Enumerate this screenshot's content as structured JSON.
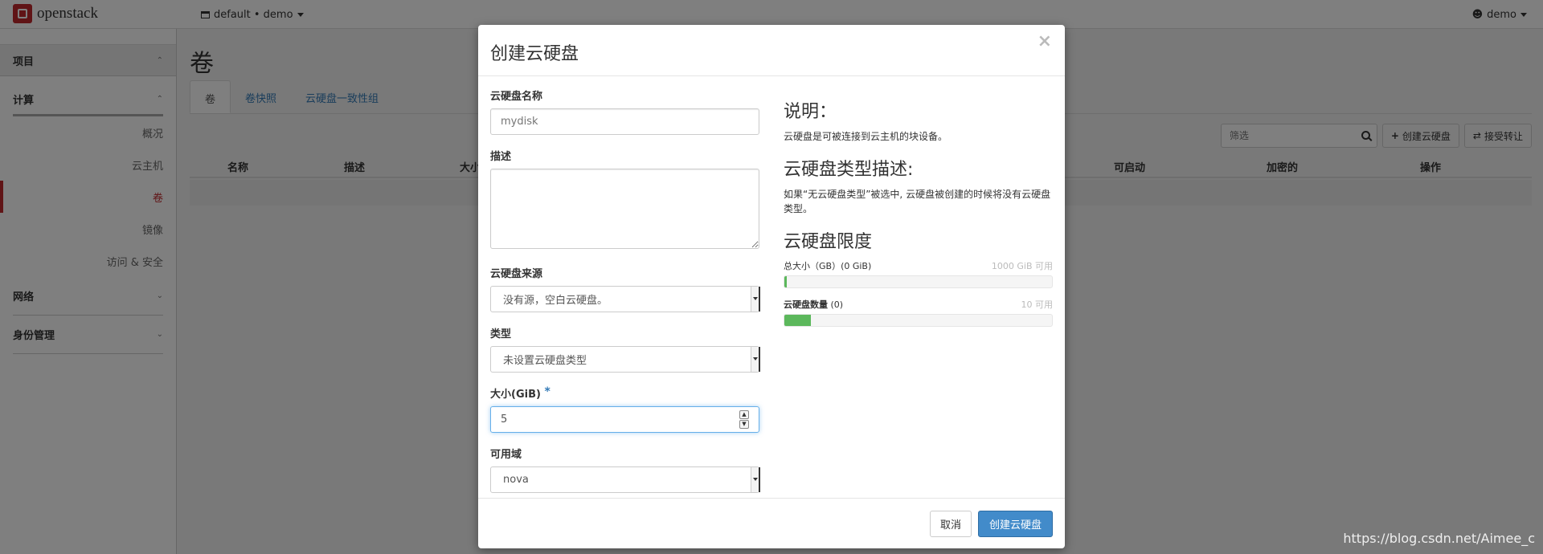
{
  "navbar": {
    "brand": "openstack",
    "project": "default • demo",
    "user": "demo"
  },
  "sidebar": {
    "groups": [
      {
        "label": "项目"
      },
      {
        "label": "计算"
      },
      {
        "label": "网络"
      },
      {
        "label": "身份管理"
      }
    ],
    "compute_items": [
      {
        "label": "概况"
      },
      {
        "label": "云主机"
      },
      {
        "label": "卷"
      },
      {
        "label": "镜像"
      },
      {
        "label": "访问 & 安全"
      }
    ]
  },
  "main": {
    "title": "卷",
    "tabs": [
      {
        "label": "卷"
      },
      {
        "label": "卷快照"
      },
      {
        "label": "云硬盘一致性组"
      }
    ],
    "filter_placeholder": "筛选",
    "create_button": "创建云硬盘",
    "accept_transfer_button": "接受转让",
    "columns": [
      "名称",
      "描述",
      "大小",
      "可启动",
      "加密的",
      "操作"
    ]
  },
  "modal": {
    "title": "创建云硬盘",
    "close": "×",
    "fields": {
      "name_label": "云硬盘名称",
      "name_placeholder": "mydisk",
      "desc_label": "描述",
      "source_label": "云硬盘来源",
      "source_value": "没有源，空白云硬盘。",
      "type_label": "类型",
      "type_value": "未设置云硬盘类型",
      "size_label": "大小(GiB)",
      "size_required": "*",
      "size_value": "5",
      "az_label": "可用域",
      "az_value": "nova"
    },
    "info": {
      "desc_heading": "说明：",
      "desc_text": "云硬盘是可被连接到云主机的块设备。",
      "type_heading": "云硬盘类型描述:",
      "type_text": "如果“无云硬盘类型”被选中, 云硬盘被创建的时候将没有云硬盘类型。",
      "limits_heading": "云硬盘限度",
      "quota_size_label": "总大小（GB）(0 GiB)",
      "quota_size_avail": "1000 GiB 可用",
      "quota_size_fraction": 0.005,
      "quota_count_label": "云硬盘数量",
      "quota_count_used": "(0)",
      "quota_count_avail": "10 可用",
      "quota_count_fraction": 0.1
    },
    "cancel_label": "取消",
    "submit_label": "创建云硬盘"
  },
  "watermark": "https://blog.csdn.net/Aimee_c",
  "colors": {
    "brand": "#c0282d",
    "primary": "#428bca",
    "progress": "#5cb85c"
  }
}
